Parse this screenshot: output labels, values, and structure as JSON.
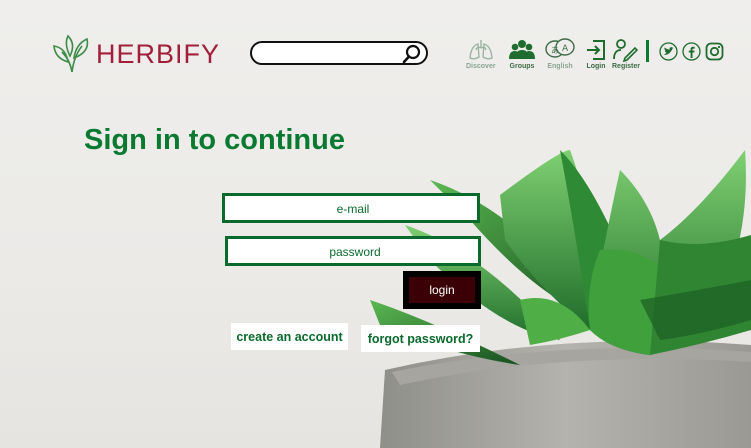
{
  "brand": {
    "name": "HERBIFY",
    "color": "#a01f3a",
    "logo_icon": "herb-leaves-icon"
  },
  "search": {
    "value": "",
    "placeholder": "",
    "icon": "search-icon"
  },
  "nav": [
    {
      "label": "Discover",
      "icon": "lungs-icon"
    },
    {
      "label": "Groups",
      "icon": "group-icon"
    },
    {
      "label": "English",
      "icon": "language-icon"
    },
    {
      "label": "Login",
      "icon": "login-icon"
    },
    {
      "label": "Register",
      "icon": "register-icon"
    }
  ],
  "social": [
    {
      "name": "twitter-icon"
    },
    {
      "name": "facebook-icon"
    },
    {
      "name": "instagram-icon"
    }
  ],
  "form": {
    "title": "Sign in to continue",
    "email_placeholder": "e-mail",
    "password_placeholder": "password",
    "login_label": "login",
    "create_account_label": "create an account",
    "forgot_password_label": "forgot password?"
  },
  "colors": {
    "accent": "#0a7a32",
    "login_button": "#3a0006",
    "field_border": "#0a6a2c"
  }
}
